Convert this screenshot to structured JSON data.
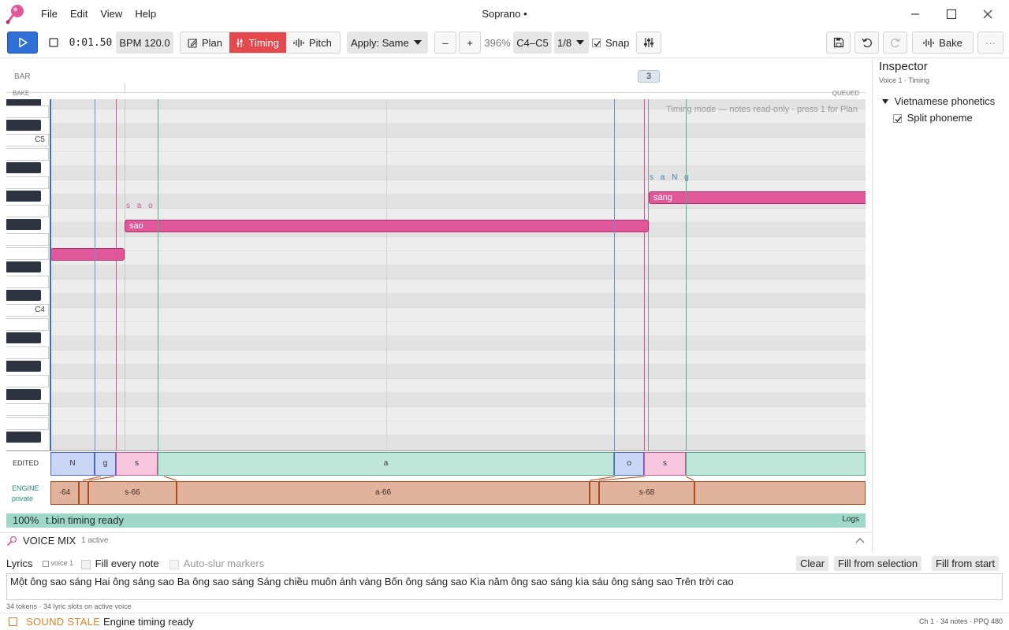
{
  "window": {
    "title": "Soprano •",
    "menu": [
      "File",
      "Edit",
      "View",
      "Help"
    ]
  },
  "toolbar": {
    "time": "0:01.50",
    "bpm": "BPM 120.0",
    "modes": [
      {
        "label": "Plan",
        "icon": "edit-icon"
      },
      {
        "label": "Timing",
        "icon": "timing-icon",
        "active": true
      },
      {
        "label": "Pitch",
        "icon": "pitch-icon"
      }
    ],
    "apply": "Apply: Same",
    "minus": "–",
    "plus": "+",
    "zoom": "396%",
    "range": "C4–C5",
    "grid": "1/8",
    "snap_label": "Snap",
    "snap_checked": true,
    "bake_label": "Bake",
    "more_label": "···"
  },
  "ruler": {
    "bar_label": "BAR",
    "bar_marker": "3",
    "bake_label": "BAKE",
    "queued_label": "QUEUED"
  },
  "piano": {
    "c5_label": "C5",
    "c4_label": "C4"
  },
  "grid": {
    "mode_hint": "Timing mode — notes read-only · press 1 for Plan"
  },
  "notes": [
    {
      "lyric": "",
      "phonemes": ""
    },
    {
      "lyric": "sao",
      "phonemes": "s a o"
    },
    {
      "lyric": "sáng",
      "phonemes": "s a N g"
    }
  ],
  "edited_row": {
    "label": "EDITED",
    "phonemes": [
      "N",
      "g",
      "s",
      "a",
      "o",
      "s",
      ""
    ]
  },
  "engine_row": {
    "label": "ENGINE",
    "sublabel": "private",
    "segments": [
      "·64",
      "",
      "s·66",
      "a·66",
      "",
      "s·68",
      ""
    ]
  },
  "status_strip": {
    "percent": "100%",
    "text": "t.bin timing ready",
    "logs": "Logs"
  },
  "voice_mix": {
    "title": "VOICE MIX",
    "badge": "1 active"
  },
  "lyrics": {
    "label": "Lyrics",
    "voice_tag": "voice 1",
    "fill_every_note": "Fill every note",
    "auto_slur": "Auto-slur markers",
    "clear": "Clear",
    "fill_from_selection": "Fill from selection",
    "fill_from_start": "Fill from start",
    "text": "Một ông sao sáng Hai ông sáng sao Ba ông sao sáng Sáng chiều muôn ánh vàng Bốn ông sáng sao Kìa năm ông sao sáng kìa sáu ông sáng sao Trên trời cao",
    "meta": "34 tokens · 34 lyric slots on active voice"
  },
  "status_bar": {
    "sound_stale": "SOUND STALE",
    "engine_status": "Engine timing ready",
    "right_info": "Ch 1 · 34 notes · PPQ 480"
  },
  "inspector": {
    "title": "Inspector",
    "subtitle": "Voice 1 · Timing",
    "section": "Vietnamese phonetics",
    "split_phoneme": "Split phoneme",
    "split_checked": true
  },
  "colors": {
    "accent_red": "#e5484d",
    "accent_blue": "#2f6fd6",
    "note_pink": "#e0579a",
    "status_green": "#9fd8c9",
    "stale_orange": "#d9822b"
  }
}
